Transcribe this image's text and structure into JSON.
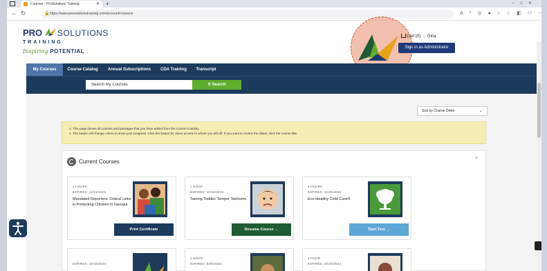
{
  "browser": {
    "tab_title": "Courses - ProSolutions Training",
    "url": "https://www.prosolutionstraining.com/account/courses/"
  },
  "logo": {
    "pro": "PRO",
    "solutions": "SOLUTIONS",
    "training": "TRAINING",
    "inspiring": "Inspiring",
    "potential": "POTENTIAL"
  },
  "header": {
    "cart": "Cart (0)",
    "user": "Gina",
    "signin_tooltip": "Sign in as Administrator"
  },
  "nav": {
    "items": [
      "My Courses",
      "Course Catalog",
      "Annual Subscriptions",
      "CDA Training",
      "Transcript"
    ]
  },
  "search": {
    "placeholder": "Search My Courses",
    "button": "Search"
  },
  "sort": {
    "selected": "Sort by Course Order"
  },
  "notice": {
    "line1": "1. This page shows all courses and packages that you have added from the Course Catalog.",
    "line2": "2. The button will change colors to show your progress. Click the button for direct access to where you left off. If you want to review the slides, click the course title."
  },
  "current_courses": {
    "heading": "Current Courses",
    "cards": [
      {
        "hours": "2 HOURS",
        "expires": "EXPIRES: 11/23/2023",
        "title": "Mandated Reporters: Critical Links in Protecting Children in Georgia",
        "action": "Print Certificate",
        "action_color": "#1c3a5c"
      },
      {
        "hours": "1 HOUR",
        "expires": "EXPIRES: 10/26/2023",
        "title": "Taming Toddler Temper Tantrums",
        "action": "Resume Course →",
        "action_color": "#1f5b33"
      },
      {
        "hours": "3 HOURS",
        "expires": "EXPIRES: 12/29/2023",
        "title": "Eco-Healthy Child Care®",
        "action": "Start Test →",
        "action_color": "#5ea8d8"
      }
    ],
    "row2": [
      {
        "hours": "",
        "expires": "EXPIRES: 10/23/2023"
      },
      {
        "hours": "1 HOUR",
        "expires": "EXPIRES: 9/30/2023"
      },
      {
        "hours": "1 HOUR",
        "expires": "EXPIRES: 10/23/2023"
      }
    ]
  },
  "colors": {
    "nav_bg": "#1c3a5c",
    "nav_active": "#4f74a9",
    "search_green": "#5fae2c",
    "notice_bg": "#f4eeb5"
  }
}
